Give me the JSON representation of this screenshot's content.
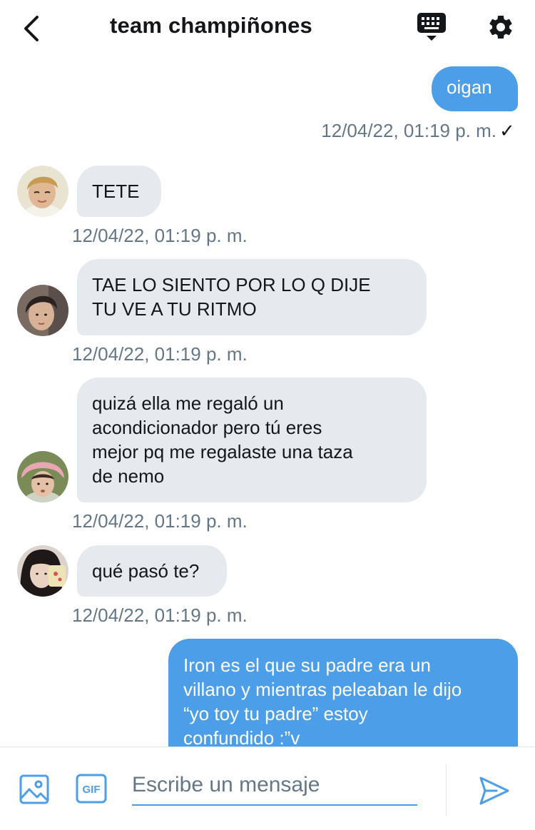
{
  "header": {
    "title": "team champiñones",
    "back_icon": "chevron-left-icon",
    "keyboard_icon": "keyboard-icon",
    "settings_icon": "gear-icon"
  },
  "messages": [
    {
      "direction": "out",
      "lines": [
        "oigan"
      ],
      "timestamp": "12/04/22, 01:19 p. m.",
      "status": "✓"
    },
    {
      "direction": "in",
      "lines": [
        "TETE"
      ],
      "timestamp": "12/04/22, 01:19 p. m."
    },
    {
      "direction": "in",
      "lines": [
        "TAE LO SIENTO POR LO Q DIJE",
        "TU VE A TU RITMO"
      ],
      "timestamp": "12/04/22, 01:19 p. m."
    },
    {
      "direction": "in",
      "lines": [
        "quizá ella me regaló un",
        "acondicionador pero tú eres",
        "mejor pq me regalaste una taza",
        "de nemo"
      ],
      "timestamp": "12/04/22, 01:19 p. m."
    },
    {
      "direction": "in",
      "lines": [
        "qué pasó te?"
      ],
      "timestamp": "12/04/22, 01:19 p. m."
    },
    {
      "direction": "out",
      "lines": [
        "Iron es el que su padre era un",
        "villano y mientras peleaban le dijo",
        "“yo toy tu padre” estoy",
        "confundido :”v"
      ]
    }
  ],
  "composer": {
    "placeholder": "Escribe un mensaje",
    "image_icon": "image-icon",
    "gif_icon": "gif-icon",
    "gif_label": "GIF",
    "send_icon": "send-icon"
  },
  "colors": {
    "accent": "#4c9ee8",
    "incoming_bubble": "#e6e9ee",
    "timestamp": "#657786",
    "text": "#14171a"
  }
}
